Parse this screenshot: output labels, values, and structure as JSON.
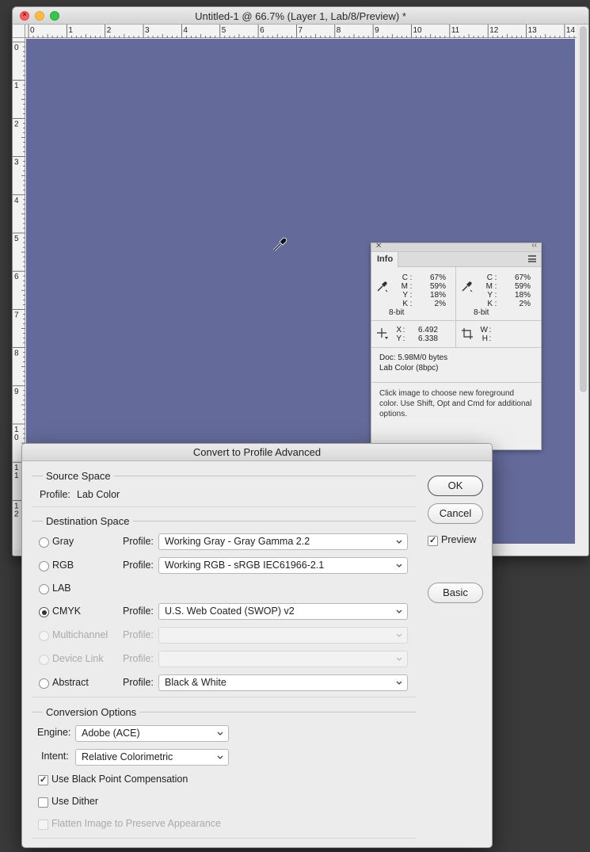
{
  "document": {
    "title": "Untitled-1 @ 66.7% (Layer 1, Lab/8/Preview) *",
    "ruler_top_labels": [
      "0",
      "1",
      "2",
      "3",
      "4",
      "5",
      "6",
      "7",
      "8",
      "9",
      "10",
      "11",
      "12",
      "13",
      "14"
    ],
    "ruler_left_labels": [
      "0",
      "1",
      "2",
      "3",
      "4",
      "5",
      "6",
      "7",
      "8",
      "9",
      "10",
      "11",
      "12"
    ],
    "canvas_color": "#646b9b"
  },
  "info_panel": {
    "tab": "Info",
    "left_color": {
      "c_label": "C",
      "c": "67%",
      "m_label": "M",
      "m": "59%",
      "y_label": "Y",
      "y": "18%",
      "k_label": "K",
      "k": "2%",
      "bit": "8-bit"
    },
    "right_color": {
      "c_label": "C",
      "c": "67%",
      "m_label": "M",
      "m": "59%",
      "y_label": "Y",
      "y": "18%",
      "k_label": "K",
      "k": "2%",
      "bit": "8-bit"
    },
    "x_label": "X",
    "x": "6.492",
    "y_label": "Y",
    "y": "6.338",
    "w_label": "W",
    "w": "",
    "h_label": "H",
    "h": "",
    "doc": "Doc: 5.98M/0 bytes",
    "mode": "Lab Color (8bpc)",
    "hint": "Click image to choose new foreground color.  Use Shift, Opt and Cmd for additional options."
  },
  "dialog": {
    "title": "Convert to Profile Advanced",
    "source": {
      "group_title": "Source Space",
      "profile_label": "Profile:",
      "profile_value": "Lab Color"
    },
    "destination": {
      "group_title": "Destination Space",
      "profile_label": "Profile:",
      "rows": [
        {
          "label": "Gray",
          "profile": "Working Gray - Gray Gamma 2.2",
          "checked": false,
          "disabled": false
        },
        {
          "label": "RGB",
          "profile": "Working RGB - sRGB IEC61966-2.1",
          "checked": false,
          "disabled": false
        },
        {
          "label": "LAB",
          "profile": "",
          "checked": false,
          "disabled": false
        },
        {
          "label": "CMYK",
          "profile": "U.S. Web Coated (SWOP) v2",
          "checked": true,
          "disabled": false
        },
        {
          "label": "Multichannel",
          "profile": "",
          "checked": false,
          "disabled": true
        },
        {
          "label": "Device Link",
          "profile": "",
          "checked": false,
          "disabled": true
        },
        {
          "label": "Abstract",
          "profile": "Black & White",
          "checked": false,
          "disabled": false
        }
      ]
    },
    "conversion": {
      "group_title": "Conversion Options",
      "engine_label": "Engine:",
      "engine_value": "Adobe (ACE)",
      "intent_label": "Intent:",
      "intent_value": "Relative Colorimetric",
      "black_point_label": "Use Black Point Compensation",
      "black_point_checked": true,
      "dither_label": "Use Dither",
      "dither_checked": false,
      "flatten_label": "Flatten Image to Preserve Appearance",
      "flatten_checked": false
    },
    "buttons": {
      "ok": "OK",
      "cancel": "Cancel",
      "preview": "Preview",
      "preview_checked": true,
      "basic": "Basic"
    }
  }
}
